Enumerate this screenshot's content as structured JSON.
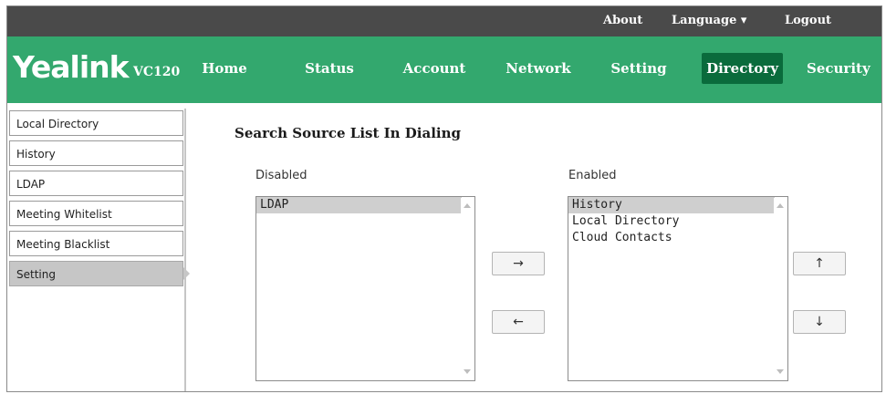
{
  "top_links": {
    "about": "About",
    "language": "Language ▾",
    "logout": "Logout"
  },
  "brand": {
    "name": "Yealink",
    "model": "VC120"
  },
  "nav": {
    "tabs": [
      {
        "label": "Home"
      },
      {
        "label": "Status"
      },
      {
        "label": "Account"
      },
      {
        "label": "Network"
      },
      {
        "label": "Setting"
      },
      {
        "label": "Directory"
      },
      {
        "label": "Security"
      }
    ],
    "active": "Directory"
  },
  "sidebar": {
    "items": [
      {
        "label": "Local Directory"
      },
      {
        "label": "History"
      },
      {
        "label": "LDAP"
      },
      {
        "label": "Meeting Whitelist"
      },
      {
        "label": "Meeting Blacklist"
      },
      {
        "label": "Setting"
      }
    ],
    "active": "Setting"
  },
  "main": {
    "title": "Search Source List In Dialing",
    "disabled": {
      "label": "Disabled",
      "options": [
        "LDAP"
      ],
      "selected": "LDAP"
    },
    "enabled": {
      "label": "Enabled",
      "options": [
        "History",
        "Local Directory",
        "Cloud Contacts"
      ],
      "selected": "History"
    },
    "buttons": {
      "move_right": "→",
      "move_left": "←",
      "move_up": "↑",
      "move_down": "↓"
    }
  },
  "colors": {
    "topbar": "#4a4a4a",
    "nav": "#33a86e",
    "nav_active": "#0a6b3c",
    "sidebar_active": "#c6c6c6"
  }
}
